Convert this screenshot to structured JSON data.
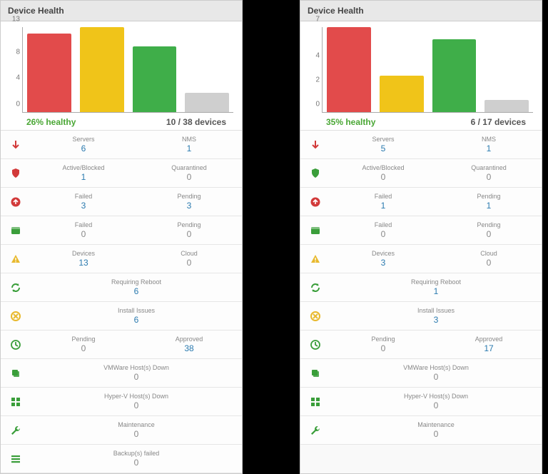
{
  "panels": [
    {
      "title": "Device Health",
      "chart_summary": {
        "healthy": "26% healthy",
        "devices": "10 / 38 devices"
      },
      "chart_ymax": 13,
      "chart_ticks": [
        0,
        4,
        8,
        13
      ],
      "rows": [
        {
          "icon": "arrow-down",
          "iconClass": "ic-red",
          "cells": [
            {
              "label": "Servers",
              "value": "6"
            },
            {
              "label": "NMS",
              "value": "1"
            }
          ]
        },
        {
          "icon": "shield",
          "iconClass": "ic-red",
          "cells": [
            {
              "label": "Active/Blocked",
              "value": "1"
            },
            {
              "label": "Quarantined",
              "value": "0"
            }
          ]
        },
        {
          "icon": "circle-up",
          "iconClass": "ic-red",
          "cells": [
            {
              "label": "Failed",
              "value": "3"
            },
            {
              "label": "Pending",
              "value": "3"
            }
          ]
        },
        {
          "icon": "window",
          "iconClass": "ic-green",
          "cells": [
            {
              "label": "Failed",
              "value": "0"
            },
            {
              "label": "Pending",
              "value": "0"
            }
          ]
        },
        {
          "icon": "warning",
          "iconClass": "ic-yellow",
          "cells": [
            {
              "label": "Devices",
              "value": "13"
            },
            {
              "label": "Cloud",
              "value": "0"
            }
          ]
        },
        {
          "icon": "refresh",
          "iconClass": "ic-green",
          "cells": [
            {
              "label": "Requiring Reboot",
              "value": "6"
            }
          ]
        },
        {
          "icon": "install",
          "iconClass": "ic-yellow",
          "cells": [
            {
              "label": "Install Issues",
              "value": "6"
            }
          ]
        },
        {
          "icon": "clock",
          "iconClass": "ic-green",
          "cells": [
            {
              "label": "Pending",
              "value": "0"
            },
            {
              "label": "Approved",
              "value": "38"
            }
          ]
        },
        {
          "icon": "stack",
          "iconClass": "ic-green",
          "cells": [
            {
              "label": "VMWare Host(s) Down",
              "value": "0"
            }
          ]
        },
        {
          "icon": "grid",
          "iconClass": "ic-green",
          "cells": [
            {
              "label": "Hyper-V Host(s) Down",
              "value": "0"
            }
          ]
        },
        {
          "icon": "wrench",
          "iconClass": "ic-green",
          "cells": [
            {
              "label": "Maintenance",
              "value": "0"
            }
          ]
        },
        {
          "icon": "bars",
          "iconClass": "ic-green",
          "cells": [
            {
              "label": "Backup(s) failed",
              "value": "0"
            }
          ]
        }
      ]
    },
    {
      "title": "Device Health",
      "chart_summary": {
        "healthy": "35% healthy",
        "devices": "6 / 17 devices"
      },
      "chart_ymax": 7,
      "chart_ticks": [
        0,
        2,
        4,
        7
      ],
      "rows": [
        {
          "icon": "arrow-down",
          "iconClass": "ic-red",
          "cells": [
            {
              "label": "Servers",
              "value": "5"
            },
            {
              "label": "NMS",
              "value": "1"
            }
          ]
        },
        {
          "icon": "shield",
          "iconClass": "ic-green",
          "cells": [
            {
              "label": "Active/Blocked",
              "value": "0"
            },
            {
              "label": "Quarantined",
              "value": "0"
            }
          ]
        },
        {
          "icon": "circle-up",
          "iconClass": "ic-red",
          "cells": [
            {
              "label": "Failed",
              "value": "1"
            },
            {
              "label": "Pending",
              "value": "1"
            }
          ]
        },
        {
          "icon": "window",
          "iconClass": "ic-green",
          "cells": [
            {
              "label": "Failed",
              "value": "0"
            },
            {
              "label": "Pending",
              "value": "0"
            }
          ]
        },
        {
          "icon": "warning",
          "iconClass": "ic-yellow",
          "cells": [
            {
              "label": "Devices",
              "value": "3"
            },
            {
              "label": "Cloud",
              "value": "0"
            }
          ]
        },
        {
          "icon": "refresh",
          "iconClass": "ic-green",
          "cells": [
            {
              "label": "Requiring Reboot",
              "value": "1"
            }
          ]
        },
        {
          "icon": "install",
          "iconClass": "ic-yellow",
          "cells": [
            {
              "label": "Install Issues",
              "value": "3"
            }
          ]
        },
        {
          "icon": "clock",
          "iconClass": "ic-green",
          "cells": [
            {
              "label": "Pending",
              "value": "0"
            },
            {
              "label": "Approved",
              "value": "17"
            }
          ]
        },
        {
          "icon": "stack",
          "iconClass": "ic-green",
          "cells": [
            {
              "label": "VMWare Host(s) Down",
              "value": "0"
            }
          ]
        },
        {
          "icon": "grid",
          "iconClass": "ic-green",
          "cells": [
            {
              "label": "Hyper-V Host(s) Down",
              "value": "0"
            }
          ]
        },
        {
          "icon": "wrench",
          "iconClass": "ic-green",
          "cells": [
            {
              "label": "Maintenance",
              "value": "0"
            }
          ]
        }
      ]
    }
  ],
  "chart_data": [
    {
      "type": "bar",
      "title": "Device Health",
      "categories": [
        "Red",
        "Yellow",
        "Green",
        "Grey"
      ],
      "values": [
        12,
        13,
        10,
        3
      ],
      "colors": [
        "#e24b4b",
        "#f0c419",
        "#3fae49",
        "#cfcfcf"
      ],
      "ylim": [
        0,
        13
      ],
      "yticks": [
        0,
        4,
        8,
        13
      ],
      "summary": {
        "healthy_pct": 26,
        "healthy_text": "26% healthy",
        "device_count": "10 / 38 devices"
      }
    },
    {
      "type": "bar",
      "title": "Device Health",
      "categories": [
        "Red",
        "Yellow",
        "Green",
        "Grey"
      ],
      "values": [
        7,
        3,
        6,
        1
      ],
      "colors": [
        "#e24b4b",
        "#f0c419",
        "#3fae49",
        "#cfcfcf"
      ],
      "ylim": [
        0,
        7
      ],
      "yticks": [
        0,
        2,
        4,
        7
      ],
      "summary": {
        "healthy_pct": 35,
        "healthy_text": "35% healthy",
        "device_count": "6 / 17 devices"
      }
    }
  ],
  "icons": {
    "arrow-down": "↓",
    "shield": "⬣",
    "circle-up": "⬆",
    "window": "▭",
    "warning": "▲",
    "refresh": "⟳",
    "install": "⊗",
    "clock": "◷",
    "stack": "▰",
    "grid": "▦",
    "wrench": "✔",
    "bars": "≡"
  }
}
